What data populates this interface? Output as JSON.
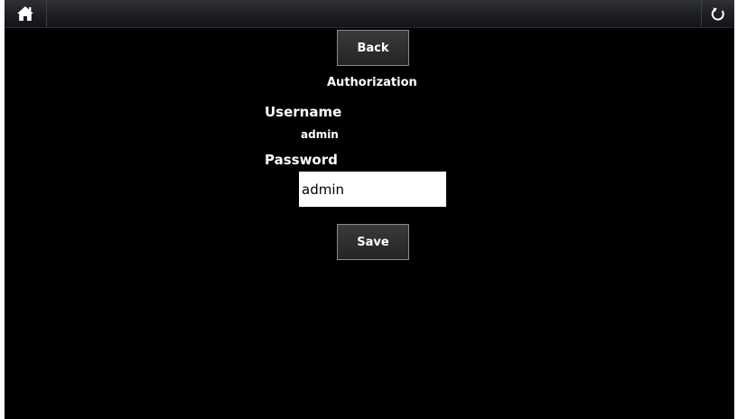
{
  "topbar": {
    "home_icon": "home-icon",
    "refresh_icon": "refresh-icon"
  },
  "buttons": {
    "back_label": "Back",
    "save_label": "Save"
  },
  "form": {
    "title": "Authorization",
    "username_label": "Username",
    "username_value": "admin",
    "password_label": "Password",
    "password_value": "admin"
  },
  "colors": {
    "background": "#000000",
    "text": "#ffffff",
    "button_border": "#8a8a8a"
  }
}
